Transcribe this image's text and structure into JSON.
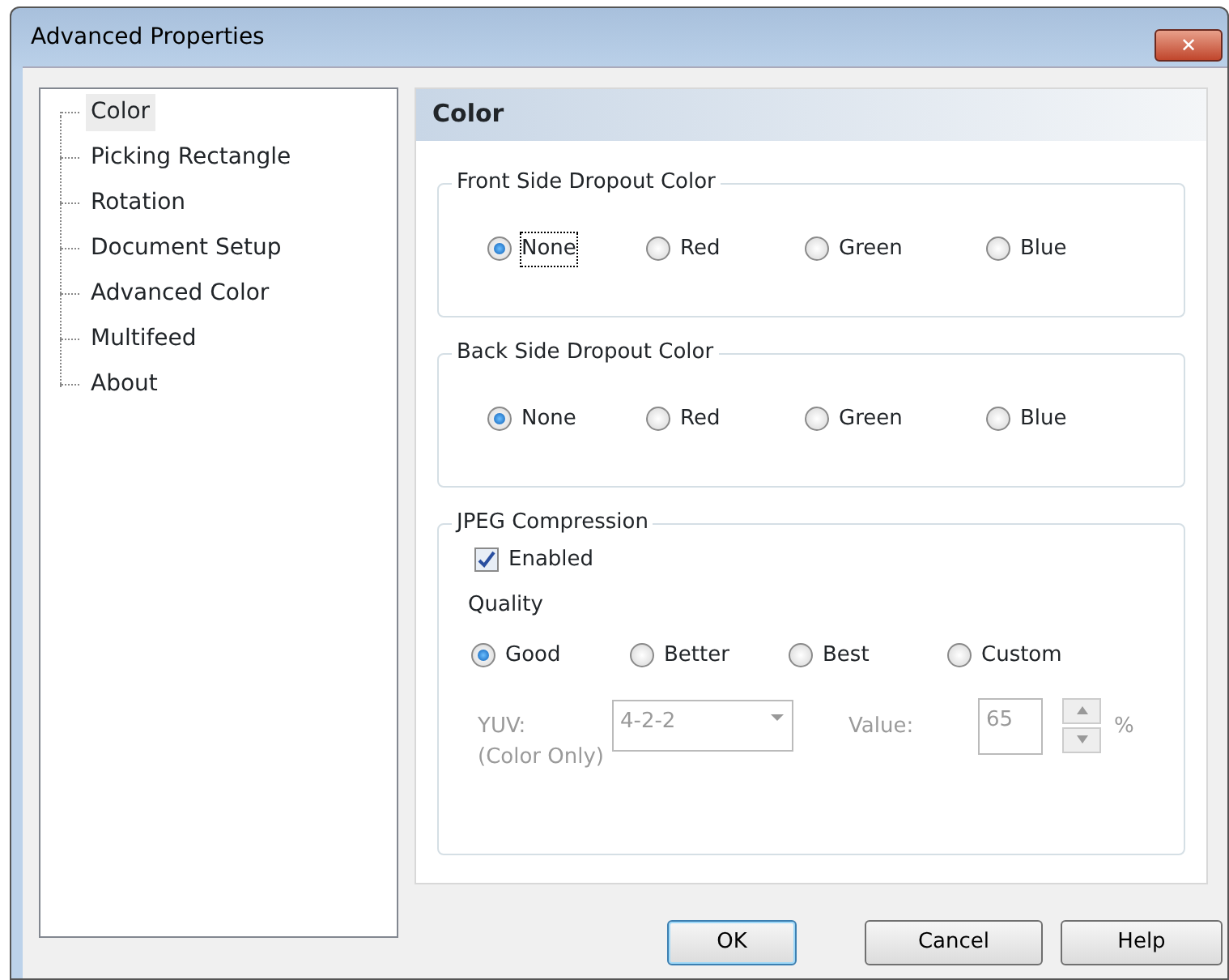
{
  "window": {
    "title": "Advanced Properties",
    "close": "✕"
  },
  "tree": {
    "items": [
      {
        "label": "Color",
        "selected": true
      },
      {
        "label": "Picking Rectangle",
        "selected": false
      },
      {
        "label": "Rotation",
        "selected": false
      },
      {
        "label": "Document Setup",
        "selected": false
      },
      {
        "label": "Advanced Color",
        "selected": false
      },
      {
        "label": "Multifeed",
        "selected": false
      },
      {
        "label": "About",
        "selected": false
      }
    ]
  },
  "panel": {
    "title": "Color",
    "front": {
      "legend": "Front Side Dropout Color",
      "options": [
        {
          "label": "None",
          "selected": true,
          "focused": true
        },
        {
          "label": "Red",
          "selected": false,
          "focused": false
        },
        {
          "label": "Green",
          "selected": false,
          "focused": false
        },
        {
          "label": "Blue",
          "selected": false,
          "focused": false
        }
      ]
    },
    "back": {
      "legend": "Back Side Dropout Color",
      "options": [
        {
          "label": "None",
          "selected": true,
          "focused": false
        },
        {
          "label": "Red",
          "selected": false,
          "focused": false
        },
        {
          "label": "Green",
          "selected": false,
          "focused": false
        },
        {
          "label": "Blue",
          "selected": false,
          "focused": false
        }
      ]
    },
    "jpeg": {
      "legend": "JPEG Compression",
      "enabled": {
        "label": "Enabled",
        "checked": true
      },
      "quality_label": "Quality",
      "quality": [
        {
          "label": "Good",
          "selected": true
        },
        {
          "label": "Better",
          "selected": false
        },
        {
          "label": "Best",
          "selected": false
        },
        {
          "label": "Custom",
          "selected": false
        }
      ],
      "yuv_label": "YUV:",
      "yuv_note": "(Color Only)",
      "yuv_value": "4-2-2",
      "value_label": "Value:",
      "value": "65",
      "unit": "%",
      "disabled": true
    }
  },
  "buttons": [
    {
      "label": "OK",
      "default": true
    },
    {
      "label": "Cancel",
      "default": false
    },
    {
      "label": "Help",
      "default": false
    }
  ]
}
